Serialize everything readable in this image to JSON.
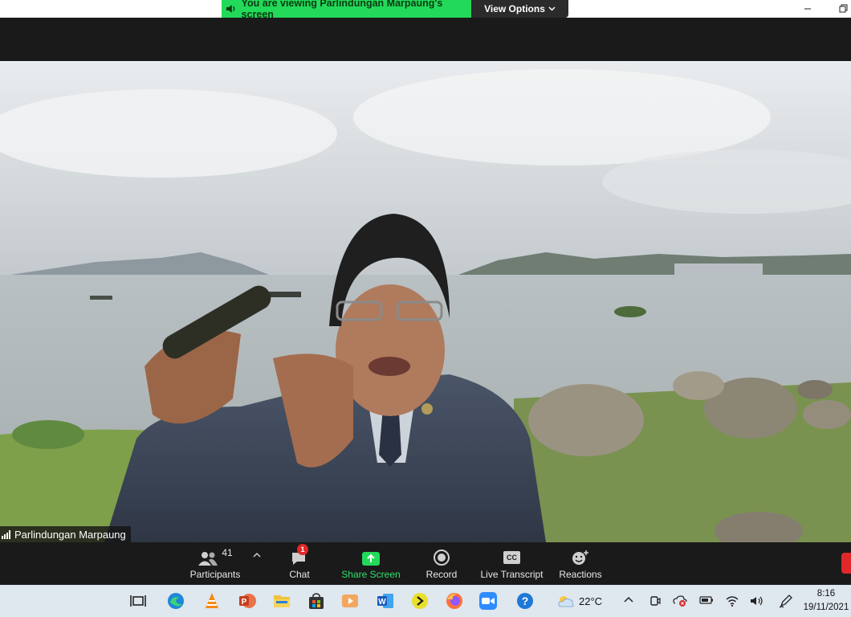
{
  "banner": {
    "viewing_text": "You are viewing Parlindungan Marpaung's screen",
    "view_options_label": "View Options"
  },
  "video": {
    "speaker_name": "Parlindungan Marpaung"
  },
  "controls": {
    "participants_label": "Participants",
    "participants_count": "41",
    "chat_label": "Chat",
    "chat_badge": "1",
    "share_label": "Share Screen",
    "record_label": "Record",
    "transcript_label": "Live Transcript",
    "transcript_icon_text": "CC",
    "reactions_label": "Reactions"
  },
  "taskbar": {
    "apps": [
      "task-view-icon",
      "edge-icon",
      "vlc-icon",
      "powerpoint-icon",
      "file-explorer-icon",
      "store-icon",
      "media-player-icon",
      "word-icon",
      "app-arrow-icon",
      "firefox-icon",
      "zoom-icon"
    ],
    "weather_temp": "22°C",
    "time": "8:16",
    "date": "19/11/2021"
  },
  "colors": {
    "banner_green": "#23d959",
    "dark_bg": "#1a1a1a",
    "share_green": "#23d959",
    "badge_red": "#e02828",
    "taskbar_bg": "#dfe7ef"
  }
}
